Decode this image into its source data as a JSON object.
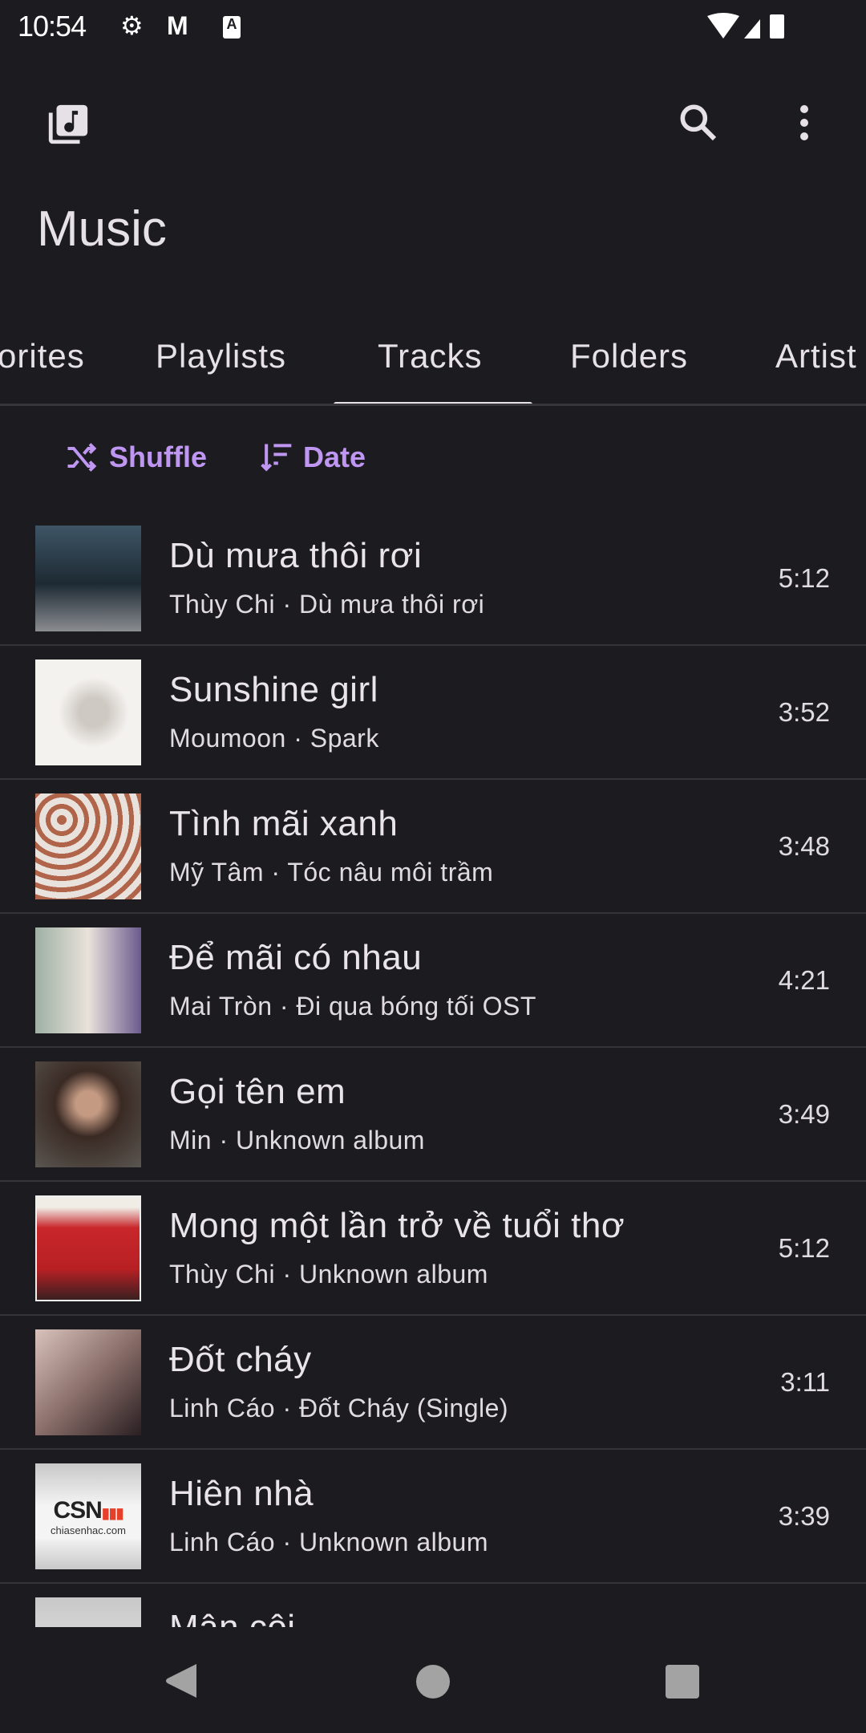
{
  "status_bar": {
    "time": "10:54",
    "icons": [
      "gear-icon",
      "gmail-icon",
      "keyboard-a-icon",
      "wifi-icon",
      "signal-icon",
      "battery-icon"
    ]
  },
  "toolbar": {
    "app_icon": "music-library-icon",
    "search_icon": "search-icon",
    "more_icon": "more-vert-icon"
  },
  "header": {
    "title": "Music"
  },
  "tabs": [
    {
      "label": "Favorites",
      "visible_label": "orites"
    },
    {
      "label": "Playlists"
    },
    {
      "label": "Tracks",
      "selected": true
    },
    {
      "label": "Folders"
    },
    {
      "label": "Artist"
    }
  ],
  "actions": {
    "shuffle": "Shuffle",
    "sort": "Date"
  },
  "colors": {
    "background": "#1c1b20",
    "accent": "#bf97f3",
    "text": "#e6e1e6"
  },
  "tracks": [
    {
      "title": "Dù mưa thôi rơi",
      "subtitle": "Thùy Chi · Dù mưa thôi rơi",
      "duration": "5:12"
    },
    {
      "title": "Sunshine girl",
      "subtitle": "Moumoon · Spark",
      "duration": "3:52"
    },
    {
      "title": "Tình mãi xanh",
      "subtitle": "Mỹ Tâm · Tóc nâu môi trầm",
      "duration": "3:48"
    },
    {
      "title": "Để mãi có nhau",
      "subtitle": "Mai Tròn · Đi qua bóng tối OST",
      "duration": "4:21"
    },
    {
      "title": "Gọi tên em",
      "subtitle": "Min · Unknown album",
      "duration": "3:49"
    },
    {
      "title": "Mong một lần trở về tuổi thơ",
      "subtitle": "Thùy Chi · Unknown album",
      "duration": "5:12"
    },
    {
      "title": "Đốt cháy",
      "subtitle": "Linh Cáo · Đốt Cháy (Single)",
      "duration": "3:11"
    },
    {
      "title": "Hiên nhà",
      "subtitle": "Linh Cáo · Unknown album",
      "duration": "3:39"
    },
    {
      "title": "Mân côi",
      "subtitle": "",
      "duration": ""
    }
  ],
  "thumb_logo": {
    "brand": "CSN",
    "site": "chiasenhac.com"
  }
}
